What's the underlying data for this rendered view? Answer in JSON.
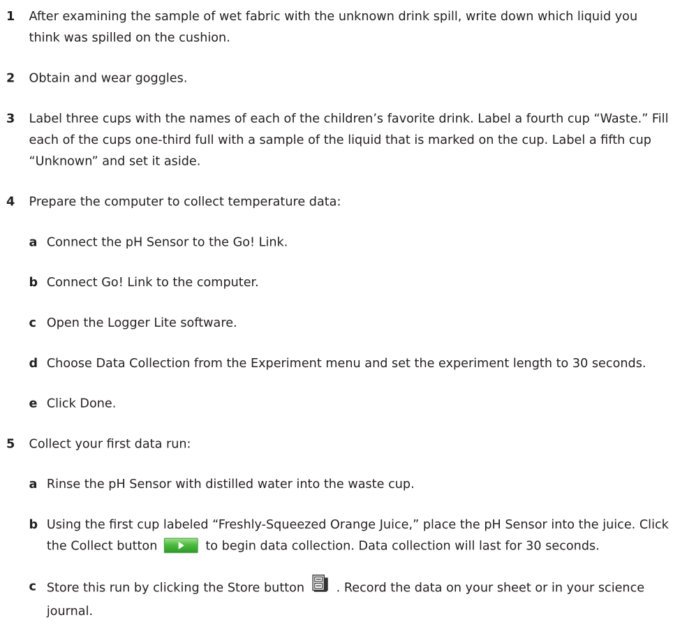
{
  "steps": [
    {
      "num": "1",
      "text": "After examining the sample of wet fabric with the unknown drink spill, write down which liquid you think was spilled on the cushion."
    },
    {
      "num": "2",
      "text": "Obtain and wear goggles."
    },
    {
      "num": "3",
      "text": "Label three cups with the names of each of the children’s favorite drink. Label a fourth cup “Waste.” Fill each of the cups one-third full with a sample of the liquid that is marked on the cup. Label a fifth cup “Unknown” and set it aside."
    },
    {
      "num": "4",
      "text": "Prepare the computer to collect temperature data:",
      "sub": [
        {
          "letter": "a",
          "text": "Connect the pH Sensor to the Go! Link."
        },
        {
          "letter": "b",
          "text": "Connect Go! Link to the computer."
        },
        {
          "letter": "c",
          "text": "Open the Logger Lite software."
        },
        {
          "letter": "d",
          "text": "Choose Data Collection from the Experiment menu and set the experiment length to 30 seconds."
        },
        {
          "letter": "e",
          "text": "Click Done."
        }
      ]
    },
    {
      "num": "5",
      "text": "Collect your first data run:",
      "sub": [
        {
          "letter": "a",
          "text": "Rinse the pH Sensor with distilled water into the waste cup."
        },
        {
          "letter": "b",
          "text_before": "Using the first cup labeled “Freshly-Squeezed Orange Juice,” place the pH Sensor into the juice. Click the Collect button",
          "text_after": "to begin data collection. Data collection will last for 30 seconds."
        },
        {
          "letter": "c",
          "text_before": "Store this run by clicking the Store button",
          "text_after": ". Record the data on your sheet or in your science journal."
        }
      ]
    }
  ],
  "icons": {
    "collect": "collect-button-icon",
    "store": "store-button-icon",
    "collect_color": "#3cb034"
  }
}
